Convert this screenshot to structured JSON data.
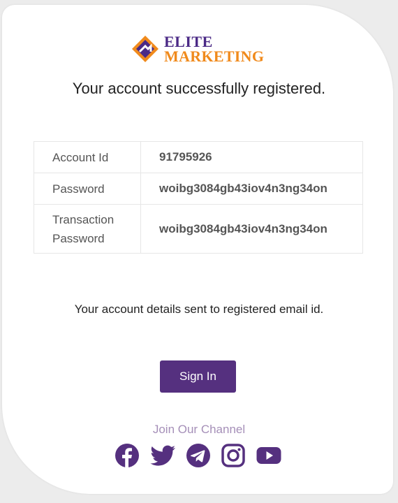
{
  "brand": {
    "line1": "ELITE",
    "line2": "MARKETING",
    "primary_color": "#4b2a86",
    "accent_color": "#f08a1c"
  },
  "headline": "Your account successfully registered.",
  "details": [
    {
      "label": "Account Id",
      "value": "91795926"
    },
    {
      "label": "Password",
      "value": "woibg3084gb43iov4n3ng34on"
    },
    {
      "label": "Transaction Password",
      "value": "woibg3084gb43iov4n3ng34on"
    }
  ],
  "notice": "Your account details sent to registered email id.",
  "signin_label": "Sign In",
  "channel_label": "Join Our Channel",
  "social_icons": [
    "facebook-icon",
    "twitter-icon",
    "telegram-icon",
    "instagram-icon",
    "youtube-icon"
  ],
  "icon_color": "#55307f"
}
